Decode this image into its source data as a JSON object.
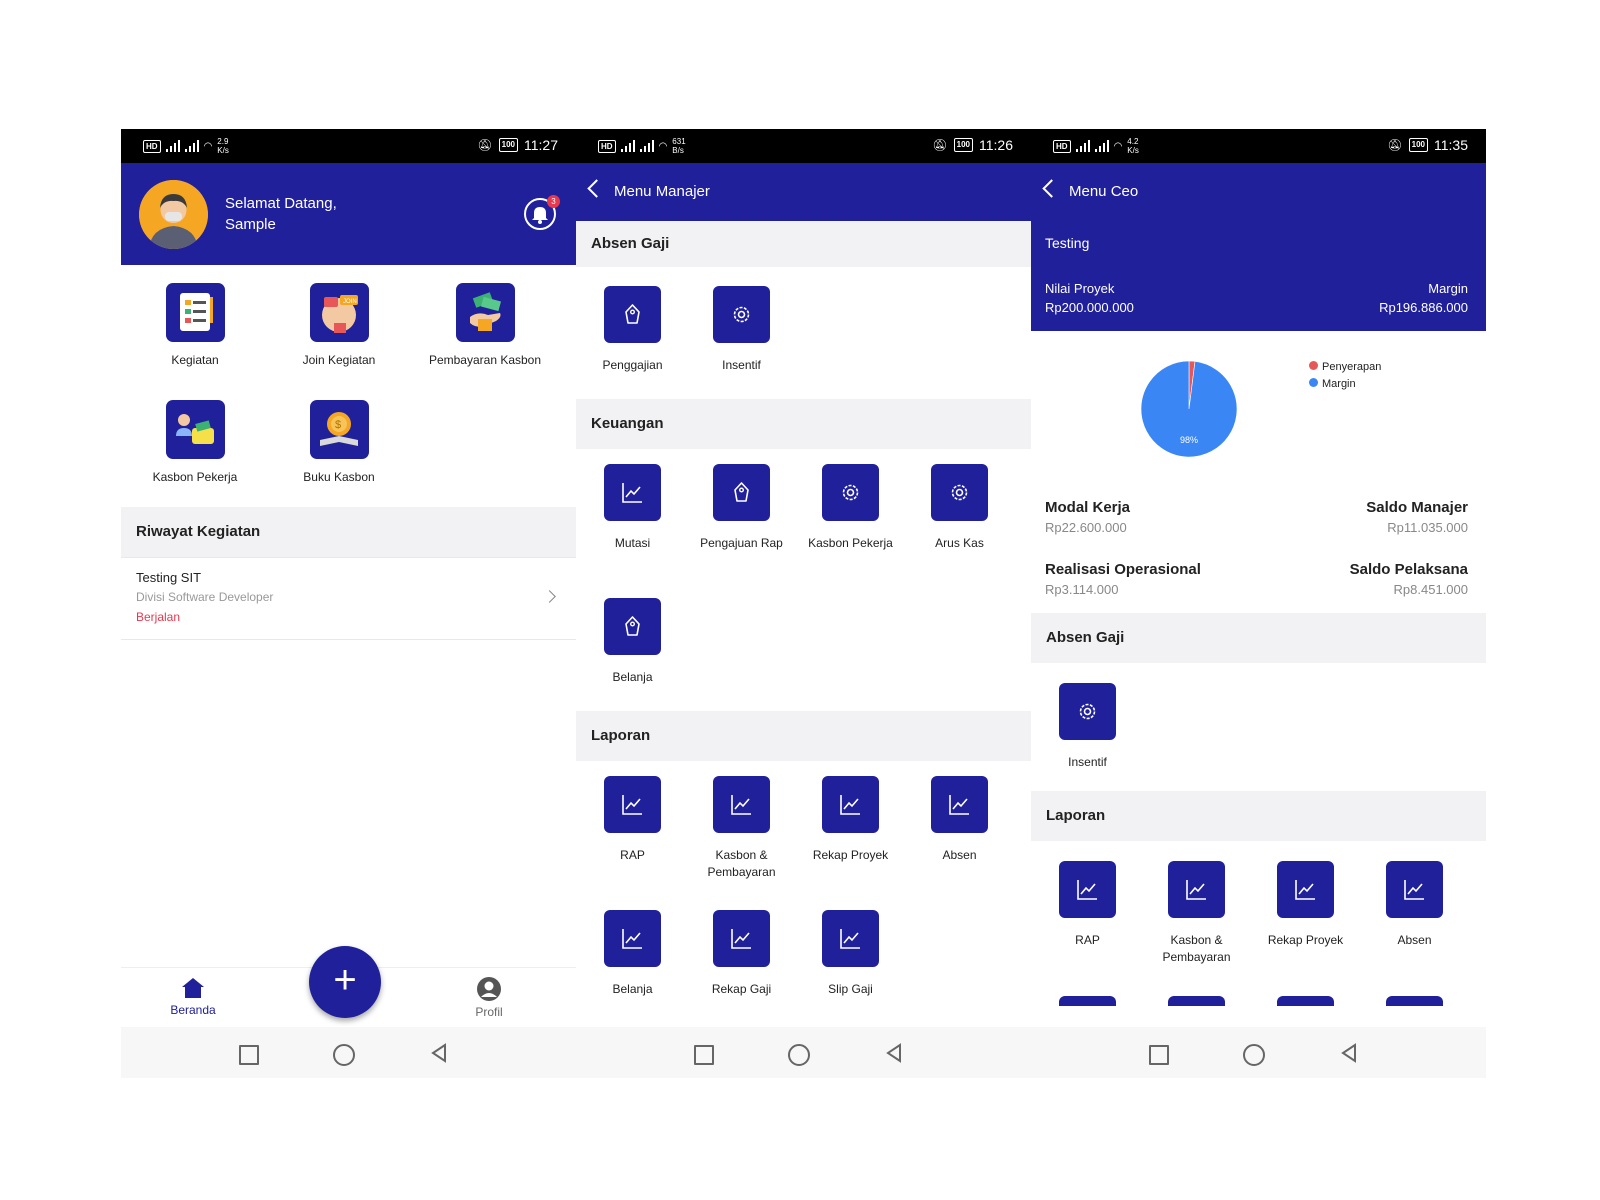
{
  "colors": {
    "primary": "#20209a",
    "accent_red": "#e53950",
    "pie_blue": "#3b86f5",
    "pie_red": "#e85757"
  },
  "status_bars": [
    {
      "speed": "2.9\nK/s",
      "time": "11:27",
      "battery": "100"
    },
    {
      "speed": "631\nB/s",
      "time": "11:26",
      "battery": "100"
    },
    {
      "speed": "4.2\nK/s",
      "time": "11:35",
      "battery": "100"
    }
  ],
  "home": {
    "greeting": "Selamat Datang,",
    "user_name": "Sample",
    "notification_count": "3",
    "menu": [
      {
        "label": "Kegiatan",
        "icon": "clipboard-list-icon"
      },
      {
        "label": "Join Kegiatan",
        "icon": "join-hand-icon"
      },
      {
        "label": "Pembayaran Kasbon",
        "icon": "money-hand-icon"
      },
      {
        "label": "Kasbon Pekerja",
        "icon": "worker-wallet-icon"
      },
      {
        "label": "Buku Kasbon",
        "icon": "coin-book-icon"
      }
    ],
    "history_title": "Riwayat Kegiatan",
    "history": [
      {
        "title": "Testing SIT",
        "division": "Divisi Software Developer",
        "status": "Berjalan"
      }
    ],
    "nav": {
      "home": "Beranda",
      "profile": "Profil",
      "fab": "+"
    }
  },
  "manager": {
    "title": "Menu Manajer",
    "sections": [
      {
        "title": "Absen Gaji",
        "items": [
          {
            "label": "Penggajian",
            "icon": "tag-icon"
          },
          {
            "label": "Insentif",
            "icon": "gear-icon"
          }
        ]
      },
      {
        "title": "Keuangan",
        "items": [
          {
            "label": "Mutasi",
            "icon": "chart-icon"
          },
          {
            "label": "Pengajuan Rap",
            "icon": "tag-icon"
          },
          {
            "label": "Kasbon Pekerja",
            "icon": "gear-icon"
          },
          {
            "label": "Arus Kas",
            "icon": "gear-icon"
          },
          {
            "label": "Belanja",
            "icon": "tag-icon"
          }
        ]
      },
      {
        "title": "Laporan",
        "items": [
          {
            "label": "RAP",
            "icon": "chart-icon"
          },
          {
            "label": "Kasbon & Pembayaran",
            "icon": "chart-icon"
          },
          {
            "label": "Rekap Proyek",
            "icon": "chart-icon"
          },
          {
            "label": "Absen",
            "icon": "chart-icon"
          },
          {
            "label": "Belanja",
            "icon": "chart-icon"
          },
          {
            "label": "Rekap Gaji",
            "icon": "chart-icon"
          },
          {
            "label": "Slip Gaji",
            "icon": "chart-icon"
          }
        ]
      }
    ]
  },
  "ceo": {
    "title": "Menu Ceo",
    "project": "Testing",
    "nilai_label": "Nilai Proyek",
    "nilai_value": "Rp200.000.000",
    "margin_label": "Margin",
    "margin_value": "Rp196.886.000",
    "pie": {
      "slices": [
        {
          "name": "Penyerapan",
          "value": 2
        },
        {
          "name": "Margin",
          "value": 98
        }
      ],
      "label": "98%"
    },
    "stats": [
      {
        "label": "Modal Kerja",
        "value": "Rp22.600.000"
      },
      {
        "label": "Saldo Manajer",
        "value": "Rp11.035.000"
      },
      {
        "label": "Realisasi Operasional",
        "value": "Rp3.114.000"
      },
      {
        "label": "Saldo Pelaksana",
        "value": "Rp8.451.000"
      }
    ],
    "sections": [
      {
        "title": "Absen Gaji",
        "items": [
          {
            "label": "Insentif",
            "icon": "gear-icon"
          }
        ]
      },
      {
        "title": "Laporan",
        "items": [
          {
            "label": "RAP",
            "icon": "chart-icon"
          },
          {
            "label": "Kasbon & Pembayaran",
            "icon": "chart-icon"
          },
          {
            "label": "Rekap Proyek",
            "icon": "chart-icon"
          },
          {
            "label": "Absen",
            "icon": "chart-icon"
          }
        ]
      }
    ]
  }
}
